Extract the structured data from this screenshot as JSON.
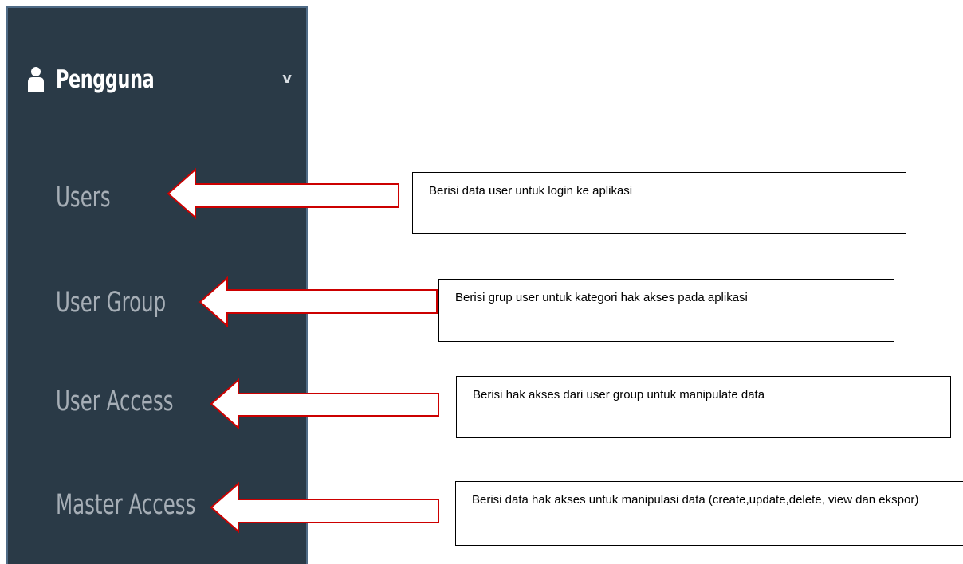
{
  "sidebar": {
    "header": {
      "label": "Pengguna",
      "icon": "user-icon",
      "toggle_icon": "chevron-down-icon"
    },
    "items": [
      {
        "label": "Users"
      },
      {
        "label": "User Group"
      },
      {
        "label": "User Access"
      },
      {
        "label": "Master Access"
      }
    ],
    "background": "#2a3a47"
  },
  "callouts": [
    {
      "text": "Berisi data user untuk login ke aplikasi"
    },
    {
      "text": "Berisi grup user untuk kategori hak akses pada aplikasi"
    },
    {
      "text": "Berisi hak akses dari user group untuk manipulate data"
    },
    {
      "text": "Berisi data hak akses untuk manipulasi data (create,update,delete, view dan ekspor)"
    }
  ],
  "arrow_color": "#cc0000"
}
